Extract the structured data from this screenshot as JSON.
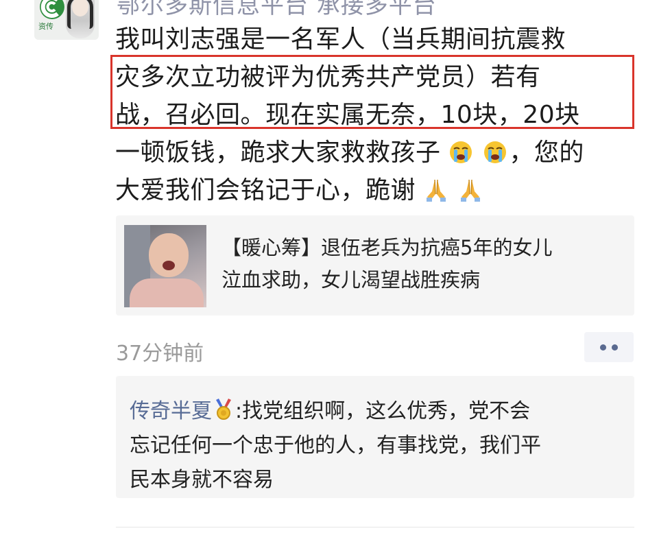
{
  "post": {
    "author_name": "鄂尔多斯信息平台 承接多平台",
    "avatar_text": "资传",
    "body_lines": [
      "我叫刘志强是一名军人（当兵期间抗震救",
      "灾多次立功被评为优秀共产党员）若有",
      "战，召必回。现在实属无奈，10块，20块",
      "一顿饭钱，跪求大家救救孩子",
      "，您的",
      "大爱我们会铭记于心，跪谢"
    ],
    "shared_link": {
      "title_line1": "【暖心筹】退伍老兵为抗癌5年的女儿",
      "title_line2": "泣血求助，女儿渴望战胜疾病"
    },
    "timestamp": "37分钟前"
  },
  "comments": [
    {
      "author": "传奇半夏",
      "separator": ":",
      "line1": "找党组织啊，这么优秀，党不会",
      "line2": "忘记任何一个忠于他的人，有事找党，我们平",
      "line3": "民本身就不容易"
    }
  ],
  "icons": {
    "more": "more-dots-icon",
    "cry_emoji": "loudly-crying-face-icon",
    "pray_emoji": "folded-hands-icon",
    "medal": "medal-icon"
  },
  "colors": {
    "highlight_border": "#d9342b",
    "link_name": "#576b95",
    "card_bg": "#f5f5f5"
  }
}
